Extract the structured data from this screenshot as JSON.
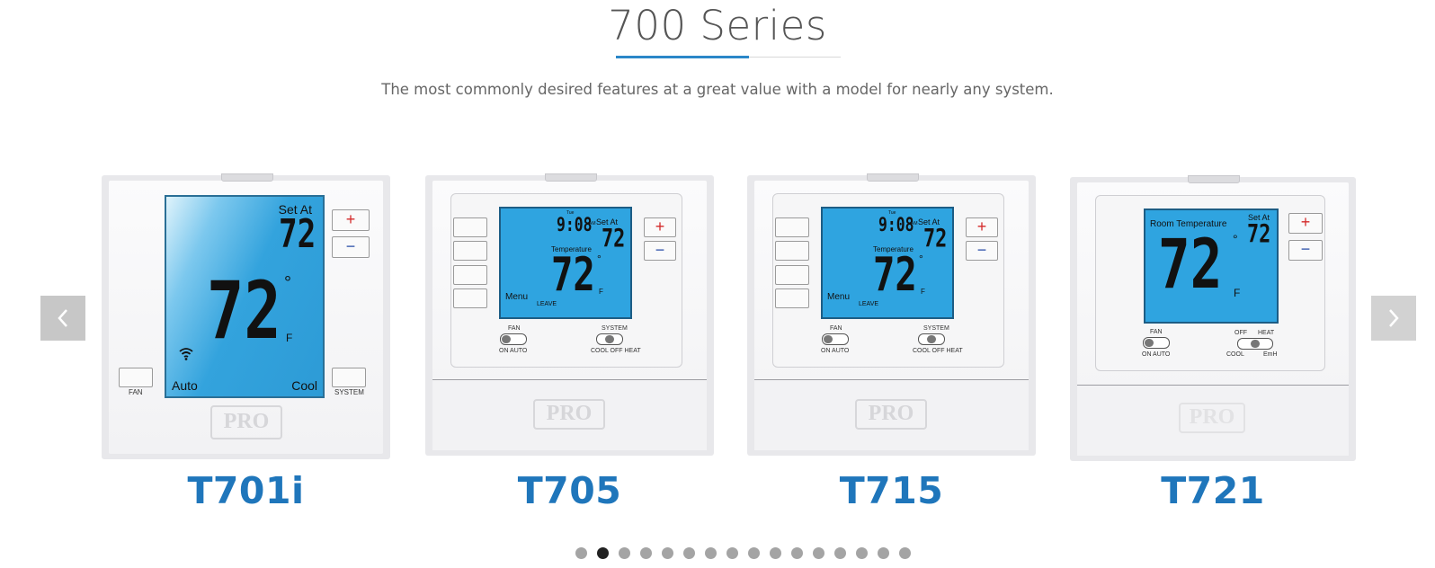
{
  "header": {
    "title": "700 Series",
    "subtitle": "The most commonly desired features at a great value with a model for nearly any system."
  },
  "carousel": {
    "prev_icon": "chevron-left-icon",
    "next_icon": "chevron-right-icon",
    "dot_count": 16,
    "active_dot": 2
  },
  "products": [
    {
      "model": "T701i",
      "set_at_label": "Set At",
      "set_temp": "72",
      "room_temp": "72",
      "degree": "°",
      "unit": "F",
      "mode_left": "Auto",
      "mode_right": "Cool",
      "fan_label": "FAN",
      "system_label": "SYSTEM",
      "plus": "+",
      "minus": "−",
      "logo": "PRO"
    },
    {
      "model": "T705",
      "day": "Tue",
      "time": "9:08",
      "ampm": "AM",
      "set_at_label": "Set At",
      "set_temp": "72",
      "temp_label": "Temperature",
      "room_temp": "72",
      "degree": "°",
      "unit": "F",
      "menu_label": "Menu",
      "leave_label": "LEAVE",
      "fan_label": "FAN",
      "fan_options": "ON   AUTO",
      "system_label": "SYSTEM",
      "system_options": "COOL  OFF  HEAT",
      "plus": "+",
      "minus": "−",
      "logo": "PRO"
    },
    {
      "model": "T715",
      "day": "Tue",
      "time": "9:08",
      "ampm": "AM",
      "set_at_label": "Set At",
      "set_temp": "72",
      "temp_label": "Temperature",
      "room_temp": "72",
      "degree": "°",
      "unit": "F",
      "menu_label": "Menu",
      "leave_label": "LEAVE",
      "fan_label": "FAN",
      "fan_options": "ON   AUTO",
      "system_label": "SYSTEM",
      "system_options": "COOL  OFF  HEAT",
      "plus": "+",
      "minus": "−",
      "logo": "PRO"
    },
    {
      "model": "T721",
      "room_temp_label": "Room Temperature",
      "set_at_label": "Set At",
      "set_temp": "72",
      "room_temp": "72",
      "degree": "°",
      "unit": "F",
      "fan_label": "FAN",
      "fan_options": "ON   AUTO",
      "sys_off": "OFF",
      "sys_heat": "HEAT",
      "sys_cool": "COOL",
      "sys_emh": "EmH",
      "plus": "+",
      "minus": "−",
      "logo": "PRO"
    }
  ]
}
